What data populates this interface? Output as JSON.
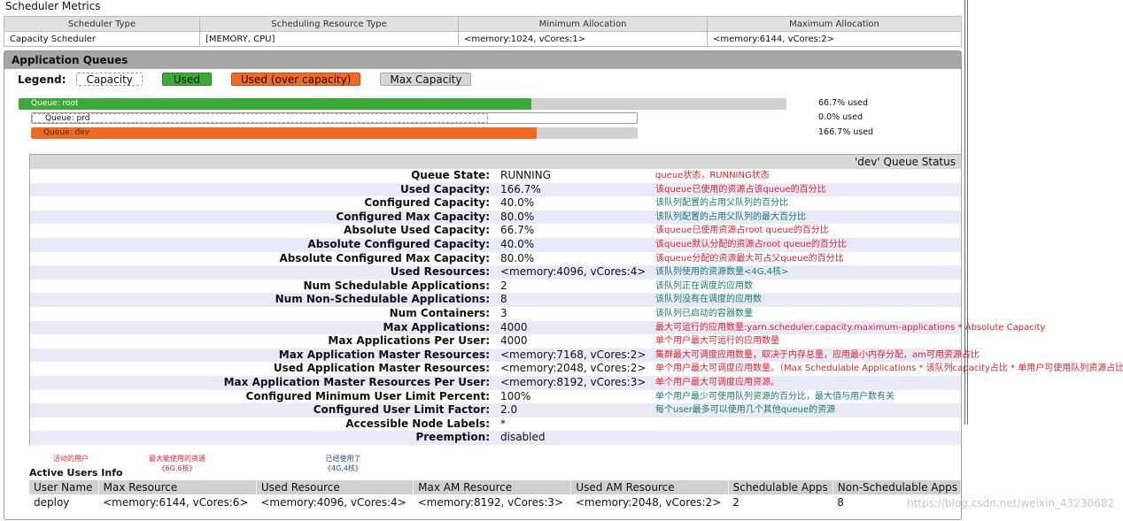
{
  "metrics": {
    "title": "Scheduler Metrics",
    "headers": [
      "Scheduler Type",
      "Scheduling Resource Type",
      "Minimum Allocation",
      "Maximum Allocation"
    ],
    "row": [
      "Capacity Scheduler",
      "[MEMORY, CPU]",
      "<memory:1024, vCores:1>",
      "<memory:6144, vCores:2>"
    ]
  },
  "queues": {
    "title": "Application Queues",
    "legend_label": "Legend:",
    "legend": [
      "Capacity",
      "Used",
      "Used (over capacity)",
      "Max Capacity"
    ],
    "bars": [
      {
        "label": "Queue: root",
        "used_pct": "66.7% used",
        "used_fraction": 0.667
      },
      {
        "label": "Queue: prd",
        "used_pct": "0.0% used",
        "used_fraction": 0
      },
      {
        "label": "Queue: dev",
        "used_pct": "166.7% used",
        "used_fraction": 1.667
      }
    ],
    "colors": {
      "used": "#3aaa35",
      "over": "#f26a21",
      "max": "#d0d0d0"
    }
  },
  "status": {
    "title": "'dev' Queue Status",
    "rows": [
      {
        "label": "Queue State:",
        "value": "RUNNING",
        "note": "queue状态，RUNNING状态",
        "c": "red"
      },
      {
        "label": "Used Capacity:",
        "value": "166.7%",
        "note": "该queue已使用的资源占该queue的百分比",
        "c": "red"
      },
      {
        "label": "Configured Capacity:",
        "value": "40.0%",
        "note": "该队列配置的占用父队列的百分比",
        "c": "teal"
      },
      {
        "label": "Configured Max Capacity:",
        "value": "80.0%",
        "note": "该队列配置的占用父队列的最大百分比",
        "c": "teal"
      },
      {
        "label": "Absolute Used Capacity:",
        "value": "66.7%",
        "note": "该queue已使用资源占root queue的百分比",
        "c": "red"
      },
      {
        "label": "Absolute Configured Capacity:",
        "value": "40.0%",
        "note": "该queue默认分配的资源占root queue的百分比",
        "c": "red"
      },
      {
        "label": "Absolute Configured Max Capacity:",
        "value": "80.0%",
        "note": "该queue分配的资源最大可占父queue的百分比",
        "c": "red"
      },
      {
        "label": "Used Resources:",
        "value": "<memory:4096, vCores:4>",
        "note": "该队列使用的资源数量<4G,4核>",
        "c": "teal"
      },
      {
        "label": "Num Schedulable Applications:",
        "value": "2",
        "note": "该队列正在调度的应用数",
        "c": "teal"
      },
      {
        "label": "Num Non-Schedulable Applications:",
        "value": "8",
        "note": "该队列没有在调度的应用数",
        "c": "teal"
      },
      {
        "label": "Num Containers:",
        "value": "3",
        "note": "该队列已启动的容器数量",
        "c": "teal"
      },
      {
        "label": "Max Applications:",
        "value": "4000",
        "note": "最大可运行的应用数量:yarn.scheduler.capacity.maximum-applications * Absolute Capacity",
        "c": "red"
      },
      {
        "label": "Max Applications Per User:",
        "value": "4000",
        "note": "单个用户最大可运行的应用数量",
        "c": "red"
      },
      {
        "label": "Max Application Master Resources:",
        "value": "<memory:7168, vCores:2>",
        "note": "集群最大可调度应用数量，取决于内存总量，应用最小内存分配，am可用资源占比",
        "c": "red"
      },
      {
        "label": "Used Application Master Resources:",
        "value": "<memory:2048, vCores:2>",
        "note": "单个用户最大可调度应用数量。（Max Schedulable Applications * 该队列capacity占比 * 单用户可使用队列资源占比",
        "c": "red"
      },
      {
        "label": "Max Application Master Resources Per User:",
        "value": "<memory:8192, vCores:3>",
        "note": "单个用户最大可调度应用资源。",
        "c": "red"
      },
      {
        "label": "Configured Minimum User Limit Percent:",
        "value": "100%",
        "note": "单个用户最少可使用队列资源的百分比，最大值与用户数有关",
        "c": "teal"
      },
      {
        "label": "Configured User Limit Factor:",
        "value": "2.0",
        "note": "每个user最多可以使用几个其他queue的资源",
        "c": "teal"
      },
      {
        "label": "Accessible Node Labels:",
        "value": "*",
        "note": "",
        "c": "teal"
      },
      {
        "label": "Preemption:",
        "value": "disabled",
        "note": "",
        "c": "teal"
      }
    ]
  },
  "users": {
    "title": "Active Users Info",
    "notes": [
      "活动的用户",
      "最大能使用的资源\n《6G,6核》",
      "已经使用了\n《4G,4核》"
    ],
    "headers": [
      "User Name",
      "Max Resource",
      "Used Resource",
      "Max AM Resource",
      "Used AM Resource",
      "Schedulable Apps",
      "Non-Schedulable Apps"
    ],
    "row": [
      "deploy",
      "<memory:6144, vCores:6>",
      "<memory:4096, vCores:4>",
      "<memory:8192, vCores:3>",
      "<memory:2048, vCores:2>",
      "2",
      "8"
    ]
  },
  "watermark": "https://blog.csdn.net/weixin_43230682"
}
